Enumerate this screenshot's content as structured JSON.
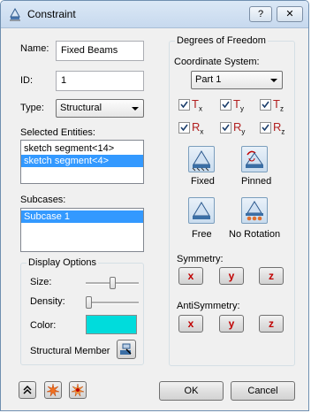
{
  "window": {
    "title": "Constraint",
    "help_label": "?",
    "close_label": "✕"
  },
  "form": {
    "name_label": "Name:",
    "name_value": "Fixed Beams",
    "id_label": "ID:",
    "id_value": "1",
    "type_label": "Type:",
    "type_value": "Structural",
    "selected_entities_label": "Selected Entities:",
    "entities": [
      "sketch segment<14>",
      "sketch segment<4>"
    ],
    "subcases_label": "Subcases:",
    "subcases": [
      "Subcase 1"
    ]
  },
  "display_options": {
    "title": "Display Options",
    "size_label": "Size:",
    "size_level": 0.5,
    "density_label": "Density:",
    "density_level": 0.0,
    "color_label": "Color:",
    "color_value": "#00dcdc",
    "structural_member_label": "Structural Member"
  },
  "dof": {
    "title": "Degrees of Freedom",
    "coord_system_label": "Coordinate System:",
    "coord_system_value": "Part 1",
    "translations": [
      {
        "base": "T",
        "sub": "x",
        "checked": true
      },
      {
        "base": "T",
        "sub": "y",
        "checked": true
      },
      {
        "base": "T",
        "sub": "z",
        "checked": true
      }
    ],
    "rotations": [
      {
        "base": "R",
        "sub": "x",
        "checked": true
      },
      {
        "base": "R",
        "sub": "y",
        "checked": true
      },
      {
        "base": "R",
        "sub": "z",
        "checked": true
      }
    ],
    "presets": {
      "fixed": "Fixed",
      "pinned": "Pinned",
      "free": "Free",
      "no_rotation": "No Rotation"
    },
    "symmetry_label": "Symmetry:",
    "antisymmetry_label": "AntiSymmetry:",
    "axis_x": "x",
    "axis_y": "y",
    "axis_z": "z"
  },
  "footer": {
    "ok_label": "OK",
    "cancel_label": "Cancel"
  },
  "colors": {
    "accent_selection": "#3399ff",
    "dof_label_red": "#b22020",
    "axis_button_red": "#c00000"
  }
}
